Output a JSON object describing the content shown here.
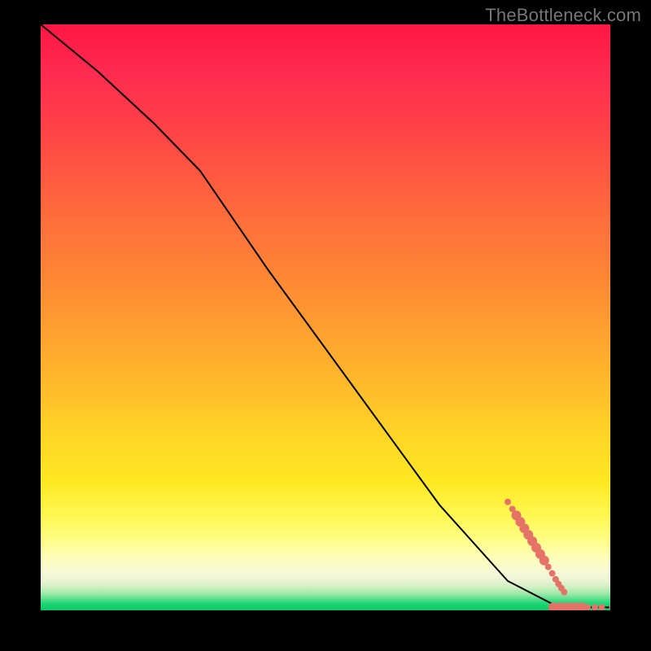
{
  "watermark": "TheBottleneck.com",
  "chart_data": {
    "type": "line",
    "title": "",
    "xlabel": "",
    "ylabel": "",
    "xlim": [
      0,
      100
    ],
    "ylim": [
      0,
      100
    ],
    "series": [
      {
        "name": "curve",
        "type": "line",
        "color": "#000000",
        "x": [
          0,
          10,
          20,
          28,
          40,
          55,
          70,
          82,
          90,
          95,
          100
        ],
        "y": [
          100,
          92,
          83,
          75,
          58,
          38,
          18,
          5,
          1,
          0.5,
          0.5
        ]
      },
      {
        "name": "points-descending",
        "type": "scatter",
        "color": "#e57368",
        "radius_small": 4,
        "radius_large": 6,
        "points": [
          {
            "x": 82.0,
            "y": 18.5,
            "r": 4
          },
          {
            "x": 82.8,
            "y": 17.3,
            "r": 4
          },
          {
            "x": 83.5,
            "y": 16.2,
            "r": 6
          },
          {
            "x": 84.2,
            "y": 15.1,
            "r": 6
          },
          {
            "x": 84.9,
            "y": 14.0,
            "r": 6
          },
          {
            "x": 85.6,
            "y": 12.9,
            "r": 6
          },
          {
            "x": 86.3,
            "y": 11.8,
            "r": 6
          },
          {
            "x": 87.0,
            "y": 10.7,
            "r": 6
          },
          {
            "x": 87.7,
            "y": 9.6,
            "r": 6
          },
          {
            "x": 88.4,
            "y": 8.5,
            "r": 6
          },
          {
            "x": 89.1,
            "y": 7.4,
            "r": 4
          },
          {
            "x": 89.8,
            "y": 6.3,
            "r": 4
          },
          {
            "x": 90.4,
            "y": 5.3,
            "r": 4
          },
          {
            "x": 90.9,
            "y": 4.5,
            "r": 4
          },
          {
            "x": 91.4,
            "y": 3.8,
            "r": 4
          },
          {
            "x": 91.9,
            "y": 3.1,
            "r": 4
          }
        ]
      },
      {
        "name": "points-bottom",
        "type": "scatter",
        "color": "#e57368",
        "points": [
          {
            "x": 90.0,
            "y": 0.5,
            "r": 6
          },
          {
            "x": 91.0,
            "y": 0.5,
            "r": 6
          },
          {
            "x": 92.0,
            "y": 0.5,
            "r": 6
          },
          {
            "x": 93.0,
            "y": 0.5,
            "r": 6
          },
          {
            "x": 94.0,
            "y": 0.5,
            "r": 6
          },
          {
            "x": 95.0,
            "y": 0.5,
            "r": 6
          },
          {
            "x": 96.0,
            "y": 0.5,
            "r": 4
          },
          {
            "x": 97.3,
            "y": 0.5,
            "r": 4
          },
          {
            "x": 98.5,
            "y": 0.5,
            "r": 4
          },
          {
            "x": 100.5,
            "y": 0.5,
            "r": 5
          },
          {
            "x": 102.0,
            "y": 0.5,
            "r": 5
          }
        ]
      }
    ]
  }
}
